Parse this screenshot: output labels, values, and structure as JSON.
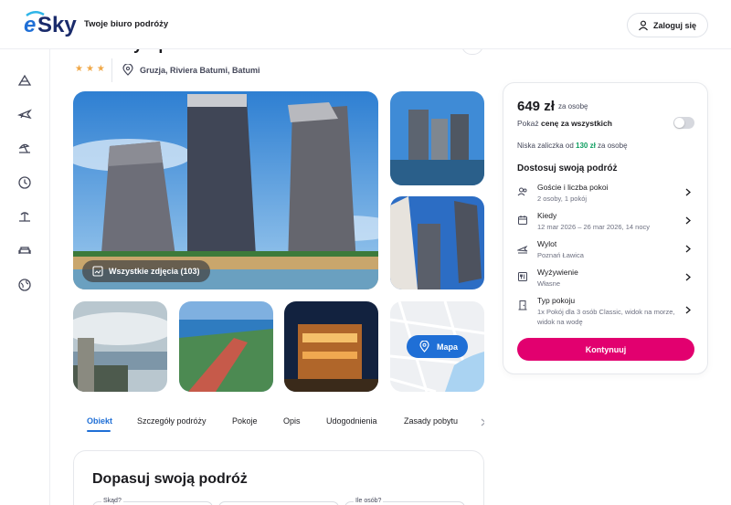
{
  "header": {
    "logo_text": "eSky",
    "tagline": "Twoje biuro podróży",
    "login_label": "Zaloguj się"
  },
  "sidebar": {
    "icons": [
      "mountain-icon",
      "plane-icon",
      "beach-icon",
      "clock-icon",
      "island-icon",
      "sofa-icon",
      "globe-icon"
    ]
  },
  "hotel": {
    "title": "Orbi City Apartments",
    "stars": "★★★",
    "location": "Gruzja, Riviera Batumi, Batumi"
  },
  "gallery": {
    "all_photos_label": "Wszystkie zdjęcia (103)",
    "map_label": "Mapa"
  },
  "tabs": [
    "Obiekt",
    "Szczegóły podróży",
    "Pokoje",
    "Opis",
    "Udogodnienia",
    "Zasady pobytu"
  ],
  "trip_card": {
    "title": "Dopasuj swoją podróż",
    "from_label": "Skąd?",
    "guests_label": "Ile osób?"
  },
  "booking": {
    "price": "649 zł",
    "price_per": "za osobę",
    "show_prefix": "Pokaż ",
    "show_bold": "cenę za wszystkich",
    "deposit_prefix": "Niska zaliczka od ",
    "deposit_amount": "130 zł",
    "deposit_suffix": " za osobę",
    "customize_title": "Dostosuj swoją podróż",
    "options": [
      {
        "label": "Goście i liczba pokoi",
        "value": "2 osoby, 1 pokój"
      },
      {
        "label": "Kiedy",
        "value": "12 mar 2026 – 26 mar 2026, 14 nocy"
      },
      {
        "label": "Wylot",
        "value": "Poznań Ławica"
      },
      {
        "label": "Wyżywienie",
        "value": "Własne"
      },
      {
        "label": "Typ pokoju",
        "value": "1x Pokój dla 3 osób Classic, widok na morze, widok na wodę"
      }
    ],
    "continue_label": "Kontynuuj"
  },
  "colors": {
    "brand_blue": "#1f6fd6",
    "accent_pink": "#e2006f",
    "deposit_green": "#0e9e60",
    "star_orange": "#f0a848"
  }
}
